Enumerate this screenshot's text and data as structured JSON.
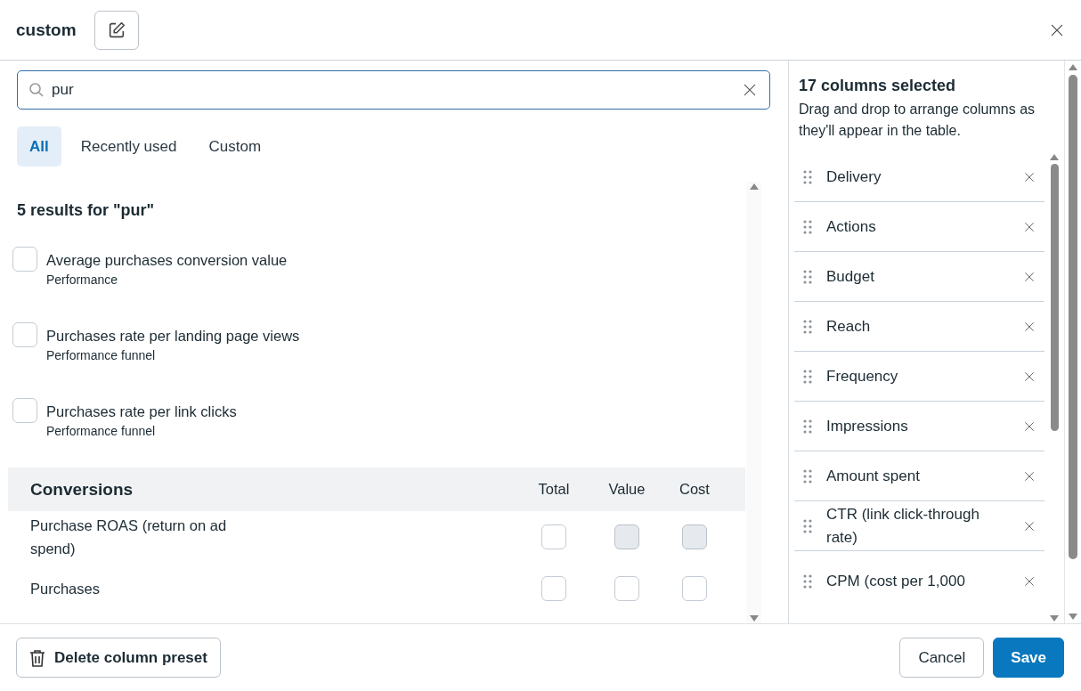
{
  "dialog": {
    "title": "custom"
  },
  "search": {
    "value": "pur"
  },
  "tabs": [
    {
      "label": "All",
      "selected": true
    },
    {
      "label": "Recently used",
      "selected": false
    },
    {
      "label": "Custom",
      "selected": false
    }
  ],
  "results": {
    "heading": "5 results for \"pur\"",
    "items": [
      {
        "label": "Average purchases conversion value",
        "category": "Performance",
        "checked": false
      },
      {
        "label": "Purchases rate per landing page views",
        "category": "Performance funnel",
        "checked": false
      },
      {
        "label": "Purchases rate per link clicks",
        "category": "Performance funnel",
        "checked": false
      }
    ]
  },
  "conversions": {
    "title": "Conversions",
    "columns": [
      "Total",
      "Value",
      "Cost"
    ],
    "rows": [
      {
        "label": "Purchase ROAS (return on ad spend)",
        "checks": [
          {
            "checked": false,
            "disabled": false
          },
          {
            "checked": false,
            "disabled": true
          },
          {
            "checked": false,
            "disabled": true
          }
        ]
      },
      {
        "label": "Purchases",
        "checks": [
          {
            "checked": false,
            "disabled": false
          },
          {
            "checked": false,
            "disabled": false
          },
          {
            "checked": false,
            "disabled": false
          }
        ]
      }
    ]
  },
  "selected_panel": {
    "title": "17 columns selected",
    "description": "Drag and drop to arrange columns as they'll appear in the table.",
    "columns": [
      "Delivery",
      "Actions",
      "Budget",
      "Reach",
      "Frequency",
      "Impressions",
      "Amount spent",
      "CTR (link click-through rate)",
      "CPM (cost per 1,000"
    ]
  },
  "footer": {
    "delete_button": "Delete column preset",
    "cancel_button": "Cancel",
    "save_button": "Save"
  }
}
